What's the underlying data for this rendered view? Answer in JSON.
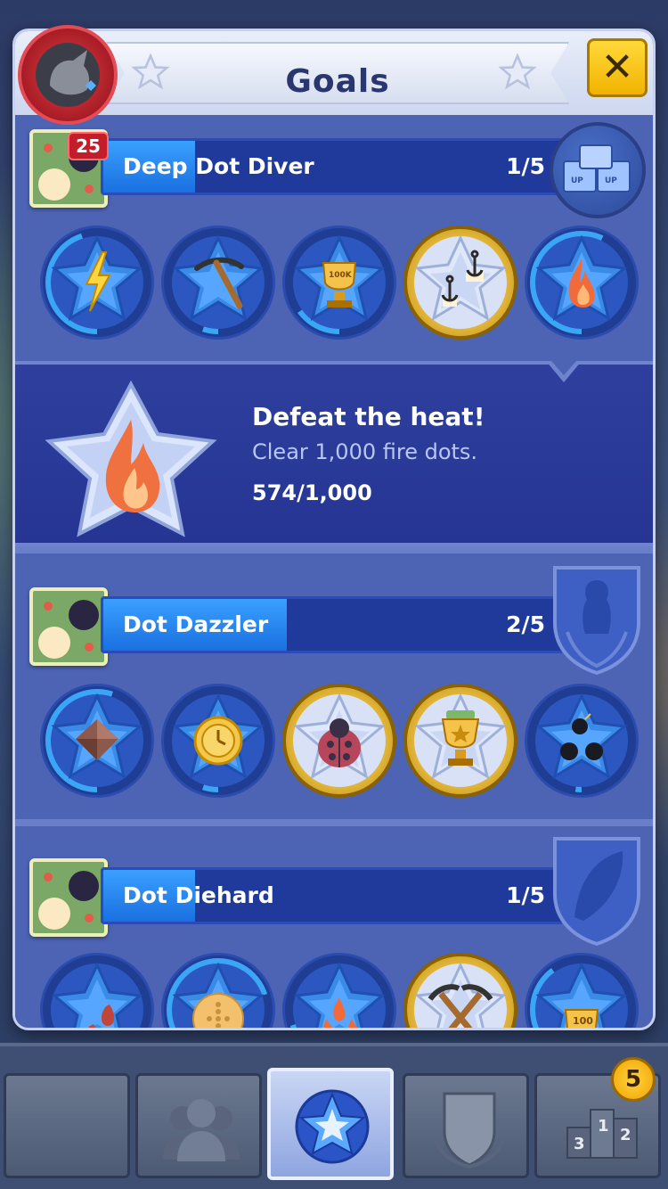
{
  "modal": {
    "title": "Goals",
    "close_label": "✕"
  },
  "sections": [
    {
      "name": "Deep Dot Diver",
      "progress_text": "1/5",
      "progress_fraction": 0.2,
      "reward_icon": "powerup-crates-icon",
      "badges": [
        {
          "icon": "lightning-icon",
          "state": "in-progress",
          "progress": 0.45
        },
        {
          "icon": "pickaxe-icon",
          "state": "in-progress",
          "progress": 0.05
        },
        {
          "icon": "trophy-100k-icon",
          "state": "in-progress",
          "progress": 0.15
        },
        {
          "icon": "anchors-icon",
          "state": "complete",
          "progress": 1.0
        },
        {
          "icon": "fire-icon",
          "state": "in-progress",
          "progress": 0.57
        }
      ]
    },
    {
      "name": "Dot Dazzler",
      "progress_text": "2/5",
      "progress_fraction": 0.4,
      "reward_icon": "shield-silhouette-icon",
      "badges": [
        {
          "icon": "square-block-icon",
          "state": "in-progress",
          "progress": 0.55
        },
        {
          "icon": "clock-icon",
          "state": "in-progress",
          "progress": 0.05
        },
        {
          "icon": "ladybug-icon",
          "state": "complete",
          "progress": 1.0
        },
        {
          "icon": "trophy-star-icon",
          "state": "complete",
          "progress": 1.0
        },
        {
          "icon": "bombs-icon",
          "state": "in-progress",
          "progress": 0.02
        }
      ]
    },
    {
      "name": "Dot Diehard",
      "progress_text": "1/5",
      "progress_fraction": 0.2,
      "reward_icon": "shield-feather-icon",
      "badges": [
        {
          "icon": "fire-drops-icon",
          "state": "in-progress",
          "progress": 0.1
        },
        {
          "icon": "dice-icon",
          "state": "in-progress",
          "progress": 0.7
        },
        {
          "icon": "triple-fire-icon",
          "state": "in-progress",
          "progress": 0.2
        },
        {
          "icon": "crossed-pickaxes-icon",
          "state": "complete",
          "progress": 1.0
        },
        {
          "icon": "trophy-100-icon",
          "state": "in-progress",
          "progress": 0.4
        }
      ]
    }
  ],
  "detail": {
    "title": "Defeat the heat!",
    "description": "Clear 1,000 fire dots.",
    "progress": "574/1,000",
    "icon": "fire-icon"
  },
  "bottom_nav": {
    "avatar_level": "25",
    "tabs": [
      "profile",
      "friends",
      "goals",
      "teams",
      "leaderboards"
    ],
    "active_tab": "goals",
    "leaderboard_badge": "5"
  },
  "colors": {
    "modal_bg": "#4d63b4",
    "bar_fill": "#1a70e0",
    "gold": "#e3b73a",
    "close_yellow": "#f2b300"
  }
}
